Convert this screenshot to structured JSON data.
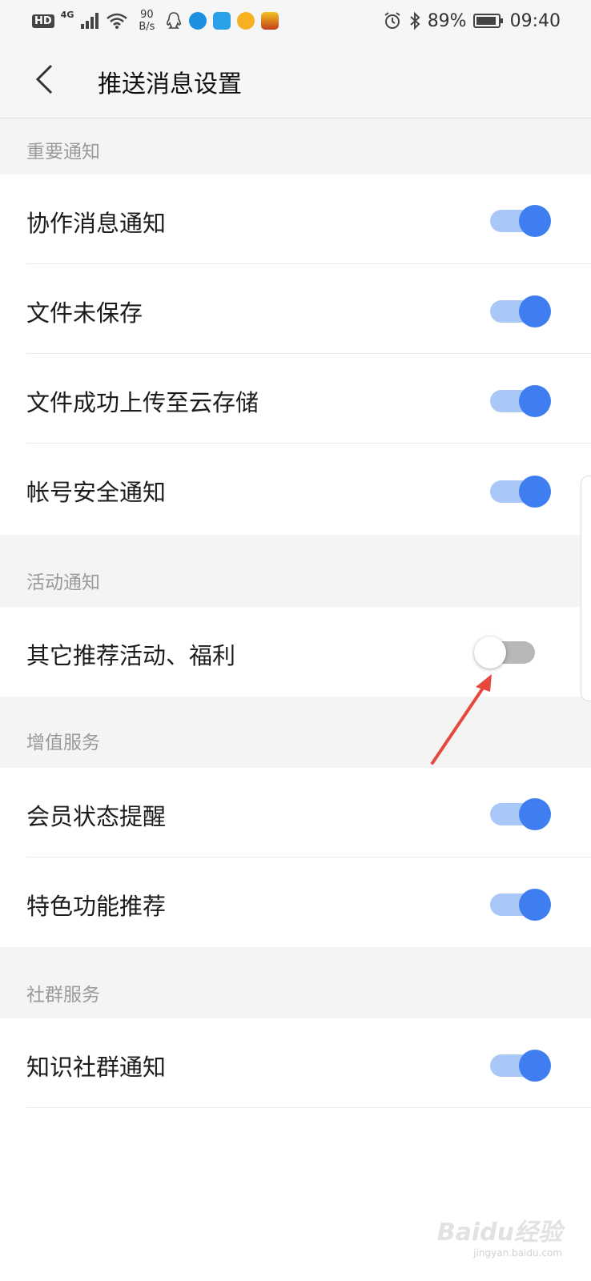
{
  "statusbar": {
    "hd": "HD",
    "network": "4G",
    "speed_value": "90",
    "speed_unit": "B/s",
    "battery": "89%",
    "time": "09:40"
  },
  "header": {
    "title": "推送消息设置"
  },
  "sections": [
    {
      "title": "重要通知",
      "items": [
        {
          "label": "协作消息通知",
          "enabled": true
        },
        {
          "label": "文件未保存",
          "enabled": true
        },
        {
          "label": "文件成功上传至云存储",
          "enabled": true
        },
        {
          "label": "帐号安全通知",
          "enabled": true
        }
      ]
    },
    {
      "title": "活动通知",
      "items": [
        {
          "label": "其它推荐活动、福利",
          "enabled": false
        }
      ]
    },
    {
      "title": "增值服务",
      "items": [
        {
          "label": "会员状态提醒",
          "enabled": true
        },
        {
          "label": "特色功能推荐",
          "enabled": true
        }
      ]
    },
    {
      "title": "社群服务",
      "items": [
        {
          "label": "知识社群通知",
          "enabled": true
        }
      ]
    }
  ],
  "colors": {
    "toggle_on_knob": "#3f7ef0",
    "toggle_on_track": "#a9c8f8",
    "toggle_off_track": "#b7b7b7",
    "annotation_arrow": "#e8473e"
  },
  "watermark": {
    "brand": "Baidu经验",
    "url": "jingyan.baidu.com"
  }
}
